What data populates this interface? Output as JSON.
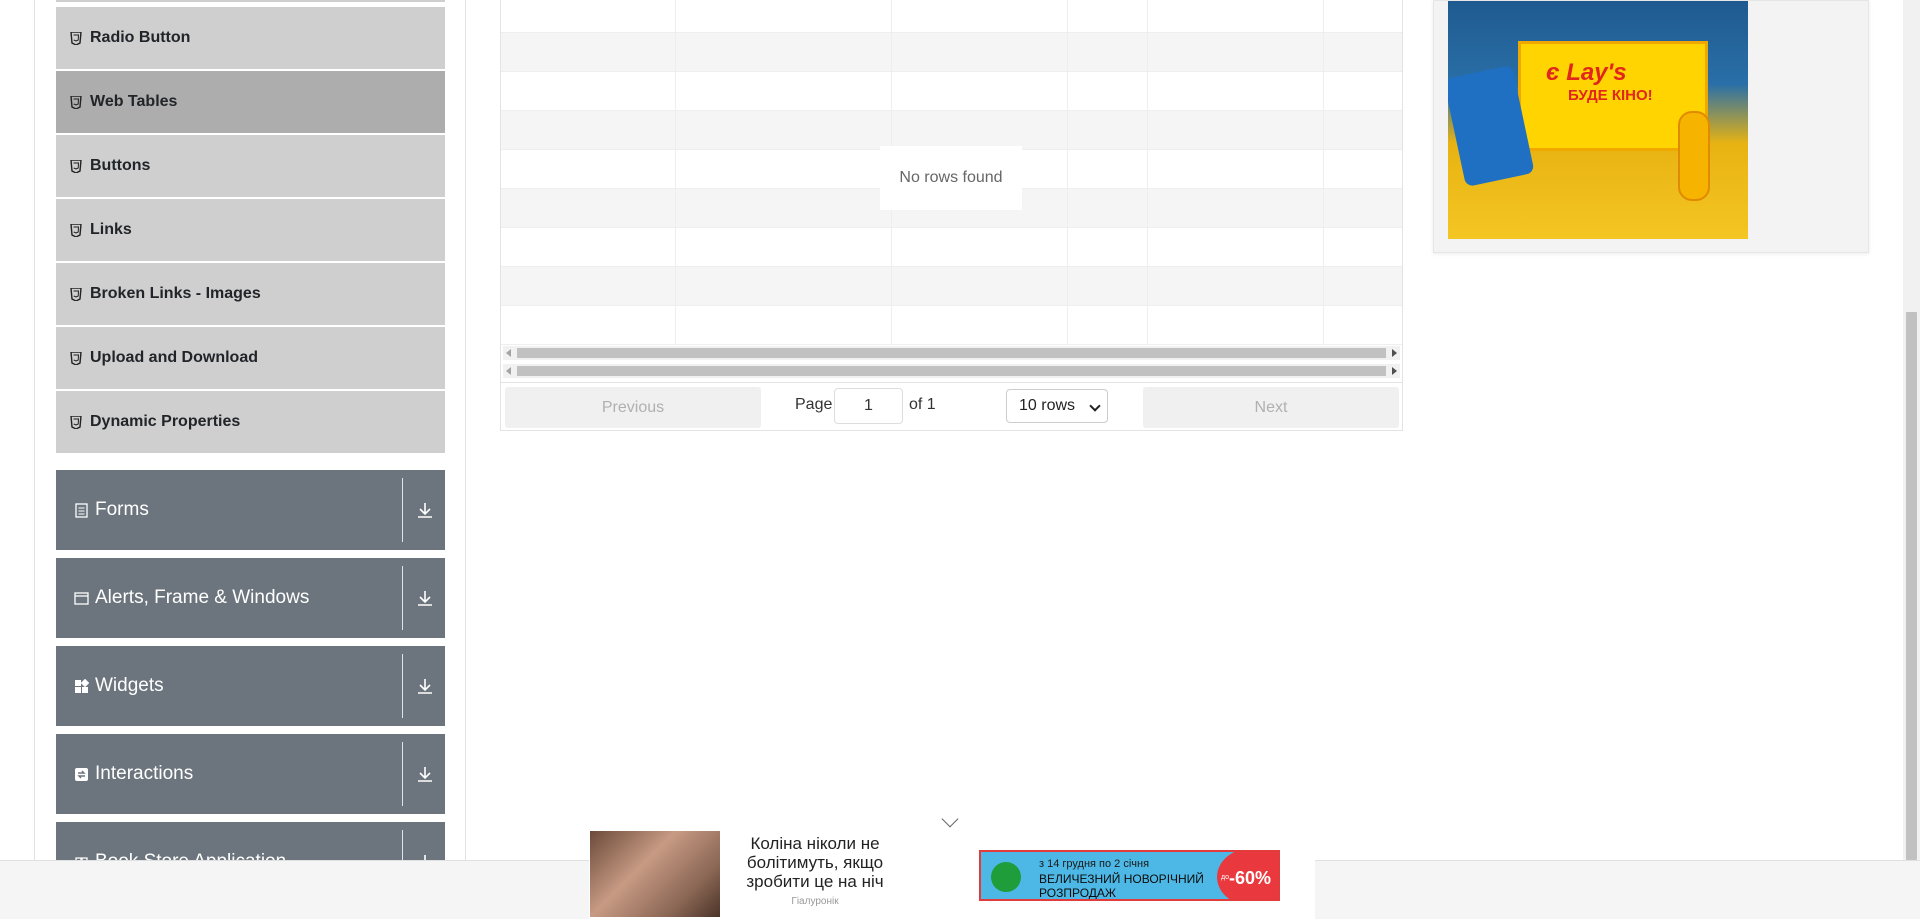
{
  "sidebar": {
    "elements_items": [
      {
        "label": "Radio Button",
        "active": false
      },
      {
        "label": "Web Tables",
        "active": true
      },
      {
        "label": "Buttons",
        "active": false
      },
      {
        "label": "Links",
        "active": false
      },
      {
        "label": "Broken Links - Images",
        "active": false
      },
      {
        "label": "Upload and Download",
        "active": false
      },
      {
        "label": "Dynamic Properties",
        "active": false
      }
    ],
    "groups": [
      {
        "label": "Forms",
        "icon": "forms-icon"
      },
      {
        "label": "Alerts, Frame & Windows",
        "icon": "window-icon"
      },
      {
        "label": "Widgets",
        "icon": "widgets-icon"
      },
      {
        "label": "Interactions",
        "icon": "interactions-icon"
      },
      {
        "label": "Book Store Application",
        "icon": "book-icon"
      }
    ]
  },
  "table": {
    "empty_message": "No rows found",
    "pagination": {
      "previous_label": "Previous",
      "next_label": "Next",
      "page_label": "Page",
      "page_value": "1",
      "of_label": "of 1",
      "rows_selected": "10 rows"
    }
  },
  "ads": {
    "right_brand": "Lay's",
    "right_prefix": "є",
    "right_tagline": "БУДЕ КІНО!",
    "bottom_text": "Коліна ніколи не болітимуть, якщо зробити це на ніч",
    "bottom_source": "Гіалуронік",
    "sale_line1": "з 14 грудня по 2 січня",
    "sale_line2": "ВЕЛИЧЕЗНИЙ НОВОРІЧНИЙ РОЗПРОДАЖ",
    "sale_prefix": "до",
    "sale_percent": "-60%"
  },
  "colors": {
    "menu_item_bg": "#cfcfcf",
    "menu_item_active_bg": "#adadad",
    "group_bg": "#6c757d"
  }
}
